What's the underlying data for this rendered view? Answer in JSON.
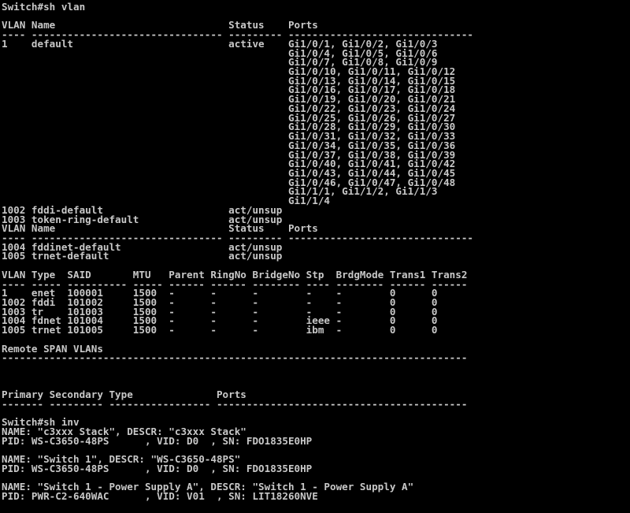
{
  "colors": {
    "background": "#000000",
    "foreground": "#c8c8c8"
  },
  "terminal": {
    "lines": [
      "Switch#sh vlan",
      "",
      "VLAN Name                             Status    Ports",
      "---- -------------------------------- --------- -------------------------------",
      "1    default                          active    Gi1/0/1, Gi1/0/2, Gi1/0/3",
      "                                                Gi1/0/4, Gi1/0/5, Gi1/0/6",
      "                                                Gi1/0/7, Gi1/0/8, Gi1/0/9",
      "                                                Gi1/0/10, Gi1/0/11, Gi1/0/12",
      "                                                Gi1/0/13, Gi1/0/14, Gi1/0/15",
      "                                                Gi1/0/16, Gi1/0/17, Gi1/0/18",
      "                                                Gi1/0/19, Gi1/0/20, Gi1/0/21",
      "                                                Gi1/0/22, Gi1/0/23, Gi1/0/24",
      "                                                Gi1/0/25, Gi1/0/26, Gi1/0/27",
      "                                                Gi1/0/28, Gi1/0/29, Gi1/0/30",
      "                                                Gi1/0/31, Gi1/0/32, Gi1/0/33",
      "                                                Gi1/0/34, Gi1/0/35, Gi1/0/36",
      "                                                Gi1/0/37, Gi1/0/38, Gi1/0/39",
      "                                                Gi1/0/40, Gi1/0/41, Gi1/0/42",
      "                                                Gi1/0/43, Gi1/0/44, Gi1/0/45",
      "                                                Gi1/0/46, Gi1/0/47, Gi1/0/48",
      "                                                Gi1/1/1, Gi1/1/2, Gi1/1/3",
      "                                                Gi1/1/4",
      "1002 fddi-default                     act/unsup",
      "1003 token-ring-default               act/unsup",
      "VLAN Name                             Status    Ports",
      "---- -------------------------------- --------- -------------------------------",
      "1004 fddinet-default                  act/unsup",
      "1005 trnet-default                    act/unsup",
      "",
      "VLAN Type  SAID       MTU   Parent RingNo BridgeNo Stp  BrdgMode Trans1 Trans2",
      "---- ----- ---------- ----- ------ ------ -------- ---- -------- ------ ------",
      "1    enet  100001     1500  -      -      -        -    -        0      0",
      "1002 fddi  101002     1500  -      -      -        -    -        0      0",
      "1003 tr    101003     1500  -      -      -        -    -        0      0",
      "1004 fdnet 101004     1500  -      -      -        ieee -        0      0",
      "1005 trnet 101005     1500  -      -      -        ibm  -        0      0",
      "",
      "Remote SPAN VLANs",
      "------------------------------------------------------------------------------",
      "",
      "",
      "",
      "Primary Secondary Type              Ports",
      "------- --------- ----------------- ------------------------------------------",
      "",
      "Switch#sh inv",
      "NAME: \"c3xxx Stack\", DESCR: \"c3xxx Stack\"",
      "PID: WS-C3650-48PS      , VID: D0  , SN: FDO1835E0HP",
      "",
      "NAME: \"Switch 1\", DESCR: \"WS-C3650-48PS\"",
      "PID: WS-C3650-48PS      , VID: D0  , SN: FDO1835E0HP",
      "",
      "NAME: \"Switch 1 - Power Supply A\", DESCR: \"Switch 1 - Power Supply A\"",
      "PID: PWR-C2-640WAC      , VID: V01  , SN: LIT18260NVE",
      ""
    ]
  }
}
